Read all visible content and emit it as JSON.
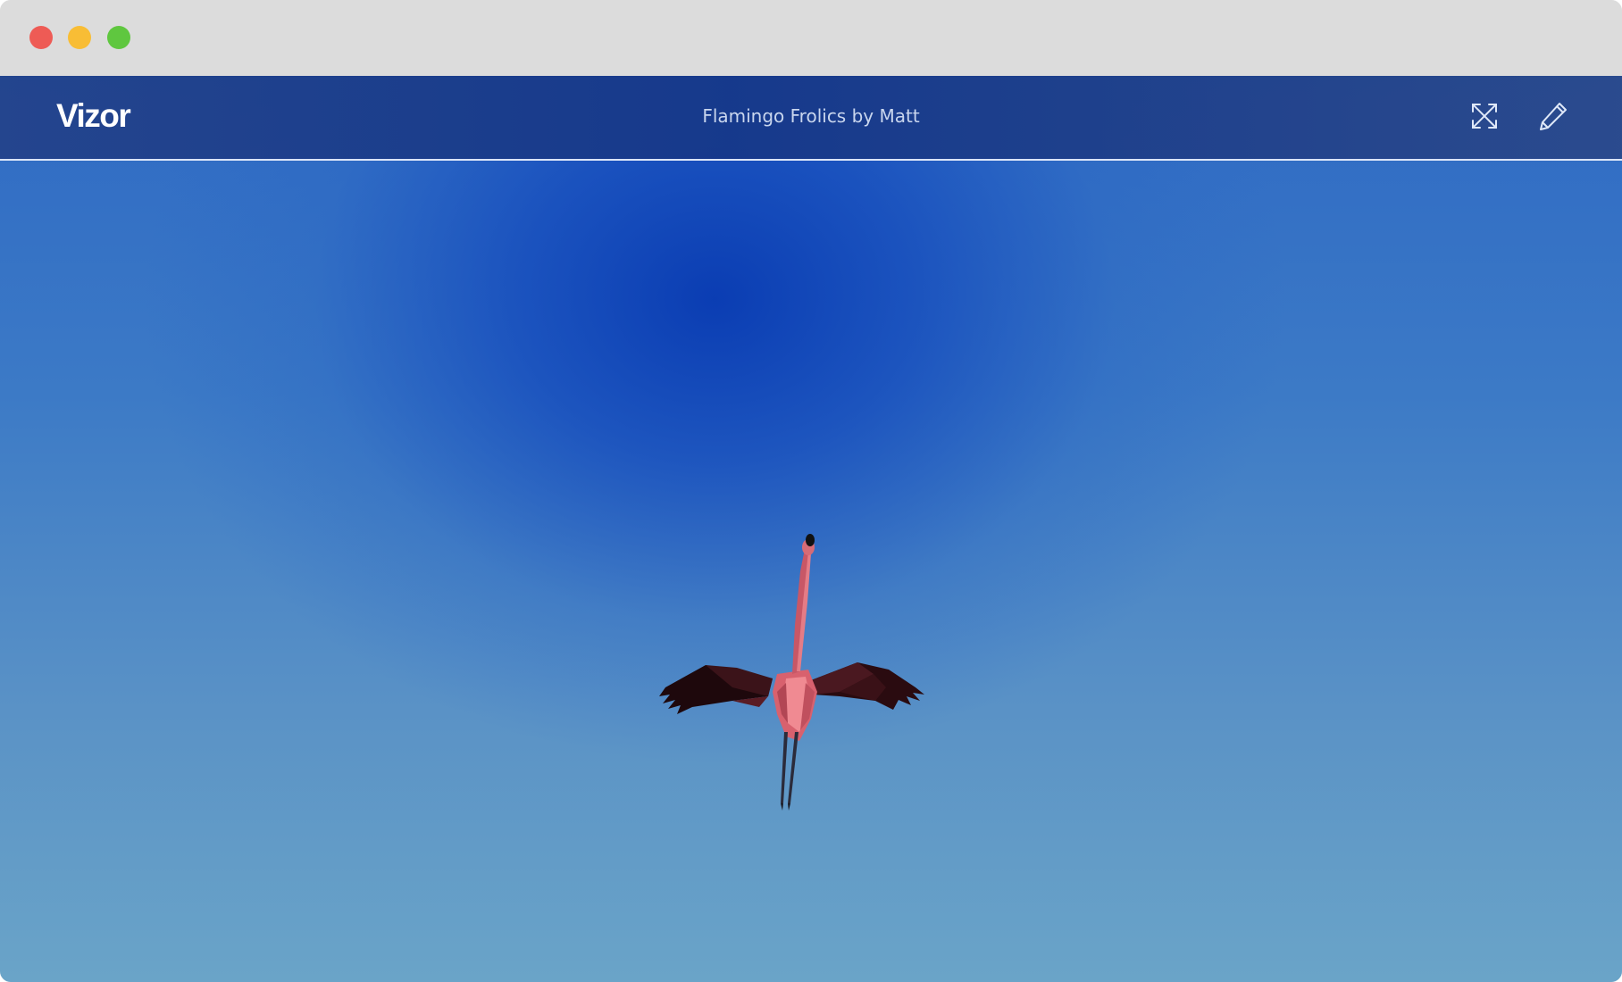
{
  "window": {
    "controls": [
      "close",
      "minimize",
      "maximize"
    ]
  },
  "app": {
    "logo": "Vizor",
    "scene_title": "Flamingo Frolics by Matt"
  },
  "toolbar": {
    "icons": [
      "fullscreen-icon",
      "pencil-icon"
    ]
  },
  "scene": {
    "subject": "flamingo",
    "colors": {
      "sky_top": "#0f3fae",
      "sky_bottom": "#6aa4c8",
      "appbar": "#1d3a86",
      "flamingo_body": "#e06f7a",
      "wing_dark": "#2a0d12"
    }
  }
}
